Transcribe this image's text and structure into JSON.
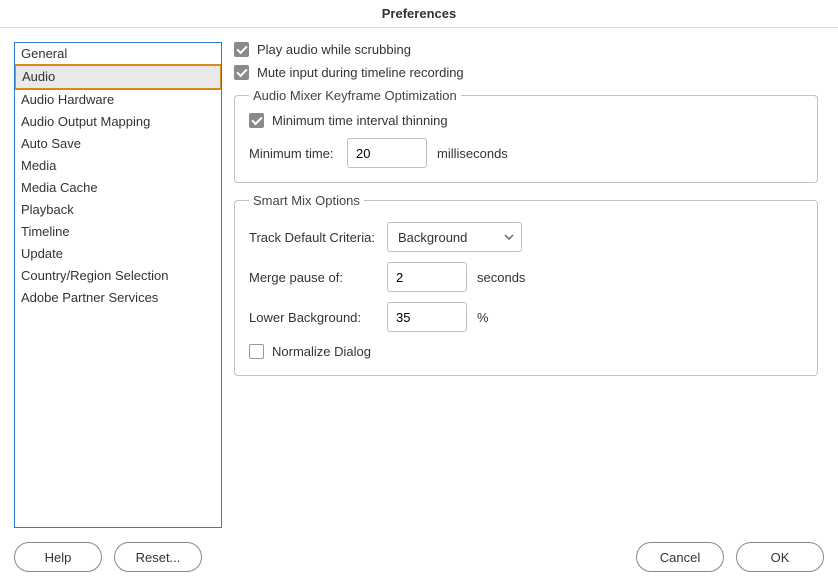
{
  "window": {
    "title": "Preferences"
  },
  "sidebar": {
    "items": [
      {
        "label": "General"
      },
      {
        "label": "Audio"
      },
      {
        "label": "Audio Hardware"
      },
      {
        "label": "Audio Output Mapping"
      },
      {
        "label": "Auto Save"
      },
      {
        "label": "Media"
      },
      {
        "label": "Media Cache"
      },
      {
        "label": "Playback"
      },
      {
        "label": "Timeline"
      },
      {
        "label": "Update"
      },
      {
        "label": "Country/Region Selection"
      },
      {
        "label": "Adobe Partner Services"
      }
    ],
    "selected_index": 1
  },
  "options": {
    "play_audio_scrubbing": {
      "label": "Play audio while scrubbing",
      "checked": true
    },
    "mute_input_recording": {
      "label": "Mute input during timeline recording",
      "checked": true
    }
  },
  "keyframe_group": {
    "legend": "Audio Mixer Keyframe Optimization",
    "thinning": {
      "label": "Minimum time interval thinning",
      "checked": true
    },
    "min_time": {
      "label": "Minimum time:",
      "value": "20",
      "unit": "milliseconds"
    }
  },
  "smartmix_group": {
    "legend": "Smart Mix Options",
    "track_default": {
      "label": "Track Default Criteria:",
      "value": "Background"
    },
    "merge_pause": {
      "label": "Merge pause of:",
      "value": "2",
      "unit": "seconds"
    },
    "lower_background": {
      "label": "Lower Background:",
      "value": "35",
      "unit": "%"
    },
    "normalize_dialog": {
      "label": "Normalize Dialog",
      "checked": false
    }
  },
  "buttons": {
    "help": "Help",
    "reset": "Reset...",
    "cancel": "Cancel",
    "ok": "OK"
  }
}
